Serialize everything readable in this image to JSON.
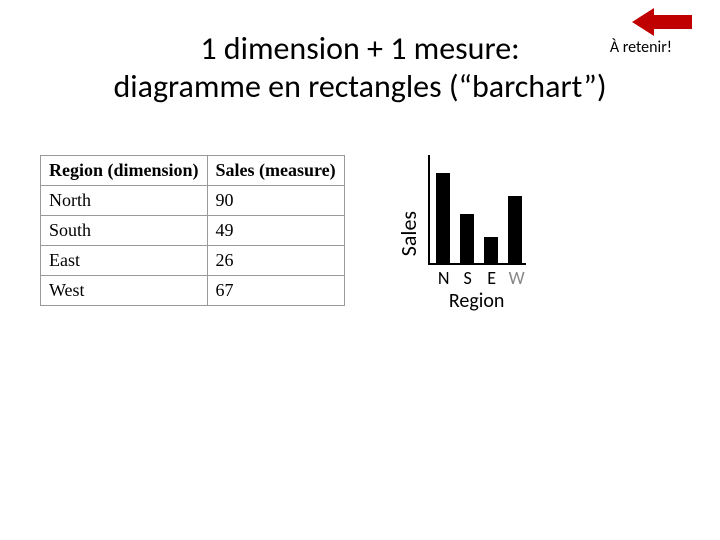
{
  "title": {
    "line1": "1 dimension + 1 mesure:",
    "line2": "diagramme en rectangles (“barchart”)"
  },
  "annotation": "À retenir!",
  "table": {
    "headers": {
      "col1": "Region (dimension)",
      "col2": "Sales (measure)"
    },
    "rows": [
      {
        "region": "North",
        "sales": "90"
      },
      {
        "region": "South",
        "sales": "49"
      },
      {
        "region": "East",
        "sales": "26"
      },
      {
        "region": "West",
        "sales": "67"
      }
    ]
  },
  "chart": {
    "ylabel": "Sales",
    "xlabel": "Region",
    "ticks": {
      "n": "N",
      "s": "S",
      "e": "E",
      "w": "W"
    }
  },
  "chart_data": {
    "type": "bar",
    "title": "",
    "xlabel": "Region",
    "ylabel": "Sales",
    "categories": [
      "N",
      "S",
      "E",
      "W"
    ],
    "values": [
      90,
      49,
      26,
      67
    ],
    "ylim": [
      0,
      100
    ]
  }
}
